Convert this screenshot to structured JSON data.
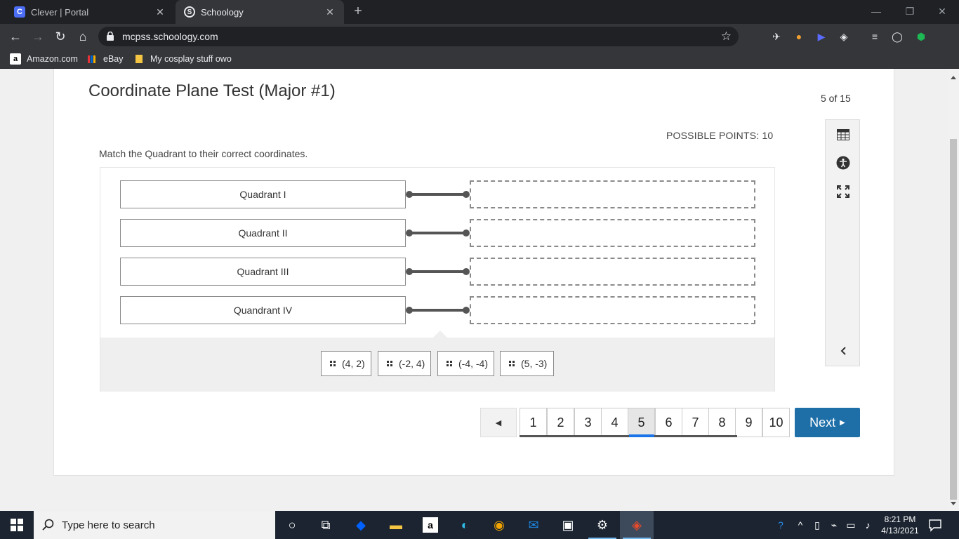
{
  "browser": {
    "tabs": [
      {
        "title": "Clever | Portal",
        "favicon": "C"
      },
      {
        "title": "Schoology",
        "favicon": "S"
      }
    ],
    "url": "mcpss.schoology.com",
    "bookmarks": [
      {
        "label": "Amazon.com",
        "icon": "amazon-icon"
      },
      {
        "label": "eBay",
        "icon": "ebay-icon"
      },
      {
        "label": "My cosplay stuff owo",
        "icon": "folder-icon"
      }
    ]
  },
  "test": {
    "title": "Coordinate Plane Test (Major #1)",
    "progress": "5 of 15",
    "points": "POSSIBLE POINTS: 10",
    "instructions": "Match the Quadrant to their correct coordinates.",
    "quadrants": [
      "Quadrant I",
      "Quadrant II",
      "Quadrant III",
      "Quandrant IV"
    ],
    "choices": [
      "(4, 2)",
      "(-2, 4)",
      "(-4, -4)",
      "(5, -3)"
    ]
  },
  "pager": {
    "pages": [
      "1",
      "2",
      "3",
      "4",
      "5",
      "6",
      "7",
      "8",
      "9",
      "10"
    ],
    "current": "5",
    "next_label": "Next"
  },
  "taskbar": {
    "search_placeholder": "Type here to search",
    "time": "8:21 PM",
    "date": "4/13/2021"
  },
  "colors": {
    "next_button": "#1e6fa8",
    "chrome_dark": "#202124",
    "taskbar": "#1b2430"
  }
}
